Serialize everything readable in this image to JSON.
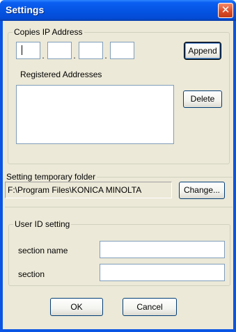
{
  "window": {
    "title": "Settings"
  },
  "ip_group": {
    "label": "Copies IP Address",
    "dot": ".",
    "append_label": "Append",
    "registered_label": "Registered Addresses",
    "delete_label": "Delete"
  },
  "folder_group": {
    "label": "Setting temporary folder",
    "path": "F:\\Program Files\\KONICA MINOLTA",
    "change_label": "Change..."
  },
  "user_group": {
    "label": "User ID setting",
    "section_name_label": "section name",
    "section_label": "section",
    "section_name_value": "",
    "section_value": ""
  },
  "footer": {
    "ok_label": "OK",
    "cancel_label": "Cancel"
  },
  "icons": {
    "close": "close-icon"
  },
  "colors": {
    "titlebar": "#0554e3",
    "client": "#ece9d8",
    "close": "#dc4c26"
  }
}
